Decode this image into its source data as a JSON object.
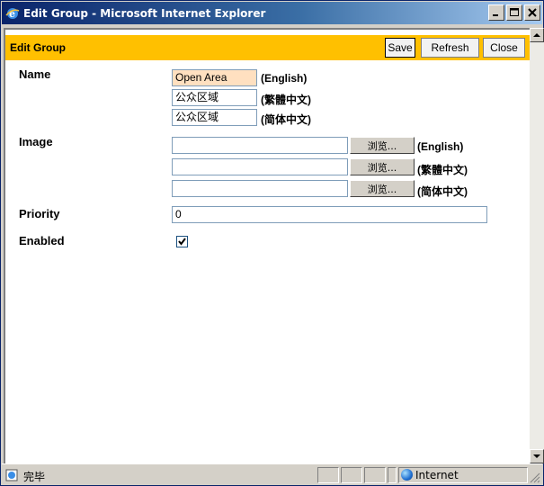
{
  "window": {
    "title": "Edit Group - Microsoft Internet Explorer",
    "minimize_glyph": "_",
    "maximize_glyph": "□",
    "close_glyph": "✕"
  },
  "header": {
    "title": "Edit Group",
    "save_label": "Save",
    "refresh_label": "Refresh",
    "close_label": "Close"
  },
  "form": {
    "name": {
      "label": "Name",
      "fields": [
        {
          "value": "Open Area",
          "suffix": "(English)"
        },
        {
          "value": "公众区域",
          "suffix": "(繁體中文)"
        },
        {
          "value": "公众区域",
          "suffix": "(简体中文)"
        }
      ]
    },
    "image": {
      "label": "Image",
      "fields": [
        {
          "value": "",
          "browse_label": "浏览...",
          "suffix": "(English)"
        },
        {
          "value": "",
          "browse_label": "浏览...",
          "suffix": "(繁體中文)"
        },
        {
          "value": "",
          "browse_label": "浏览...",
          "suffix": "(简体中文)"
        }
      ]
    },
    "priority": {
      "label": "Priority",
      "value": "0"
    },
    "enabled": {
      "label": "Enabled",
      "checked": true
    }
  },
  "statusbar": {
    "status_text": "完毕",
    "zone_text": "Internet"
  },
  "colors": {
    "header_bar": "#ffc000",
    "name_highlight": "#ffe0c0",
    "titlebar_start": "#0a246a",
    "titlebar_end": "#a6caf0"
  }
}
